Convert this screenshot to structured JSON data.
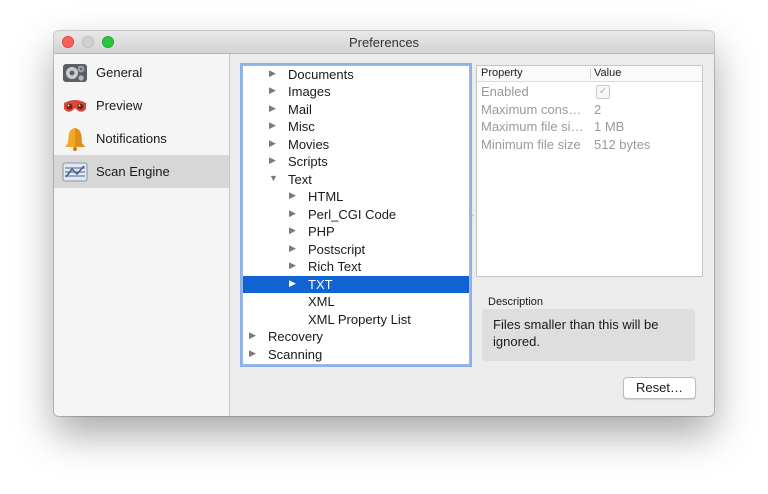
{
  "window": {
    "title": "Preferences"
  },
  "sidebar": {
    "items": [
      {
        "label": "General",
        "icon": "gears-icon"
      },
      {
        "label": "Preview",
        "icon": "preview-glasses-icon"
      },
      {
        "label": "Notifications",
        "icon": "bell-icon"
      },
      {
        "label": "Scan Engine",
        "icon": "scan-engine-icon",
        "selected": true
      }
    ]
  },
  "tree": {
    "items": [
      {
        "label": "Documents",
        "expanded": false
      },
      {
        "label": "Images",
        "expanded": false
      },
      {
        "label": "Mail",
        "expanded": false
      },
      {
        "label": "Misc",
        "expanded": false
      },
      {
        "label": "Movies",
        "expanded": false
      },
      {
        "label": "Scripts",
        "expanded": false
      },
      {
        "label": "Text",
        "expanded": true
      },
      {
        "label": "HTML",
        "expanded": false
      },
      {
        "label": "Perl_CGI Code",
        "expanded": false
      },
      {
        "label": "PHP",
        "expanded": false
      },
      {
        "label": "Postscript",
        "expanded": false
      },
      {
        "label": "Rich Text",
        "expanded": false
      },
      {
        "label": "TXT",
        "expanded": false,
        "selected": true
      },
      {
        "label": "XML"
      },
      {
        "label": "XML Property List"
      },
      {
        "label": "Recovery",
        "expanded": false
      },
      {
        "label": "Scanning",
        "expanded": false
      }
    ]
  },
  "properties": {
    "header_property": "Property",
    "header_value": "Value",
    "rows": [
      {
        "name": "Enabled",
        "value": "✓"
      },
      {
        "name": "Maximum cons…",
        "value": "2"
      },
      {
        "name": "Maximum file si…",
        "value": "1 MB"
      },
      {
        "name": "Minimum file size",
        "value": "512 bytes"
      }
    ]
  },
  "description": {
    "label": "Description",
    "text": "Files smaller than this will be ignored."
  },
  "buttons": {
    "reset": "Reset…"
  },
  "colors": {
    "selection": "#0f63d3",
    "close": "#fc5f57",
    "zoom": "#29c740"
  }
}
